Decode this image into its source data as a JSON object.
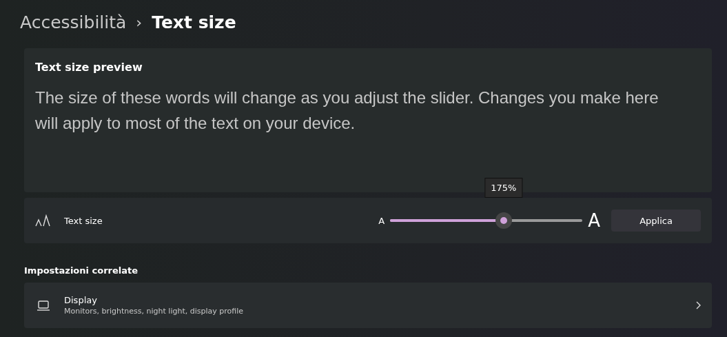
{
  "breadcrumb": {
    "parent": "Accessibilità",
    "separator": "›",
    "current": "Text size"
  },
  "preview": {
    "title": "Text size preview",
    "text": "The size of these words will change as you adjust the slider. Changes you make here will apply to most of the text on your device."
  },
  "text_size": {
    "label": "Text size",
    "small_label": "A",
    "large_label": "A",
    "level": 0.59,
    "tooltip": "175%",
    "button": "Applica"
  },
  "related": {
    "heading": "Impostazioni correlate",
    "items": [
      {
        "title": "Display",
        "subtitle": "Monitors, brightness, night light, display profile"
      }
    ]
  }
}
